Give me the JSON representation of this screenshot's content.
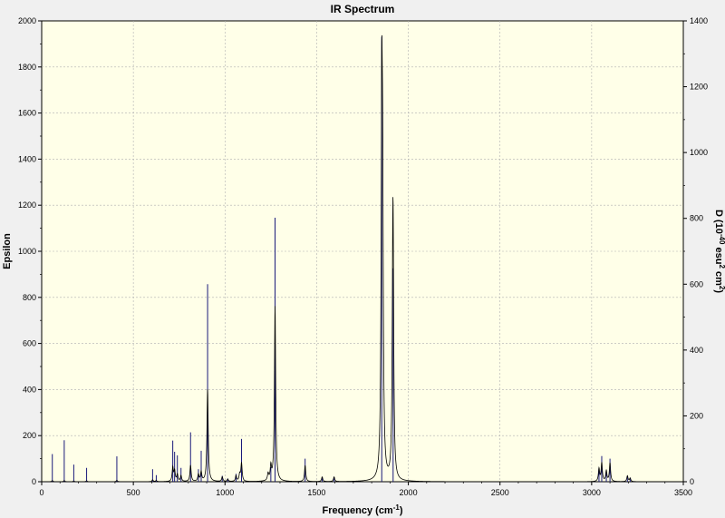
{
  "chart_data": {
    "type": "line",
    "title": "IR Spectrum",
    "xlabel": "Frequency (cm",
    "xlabel_sup": "-1",
    "xlabel_tail": ")",
    "ylabel": "Epsilon",
    "y2label_parts": [
      "D (10",
      "-40",
      " esu",
      "2",
      " cm",
      "2",
      ")"
    ],
    "xlim": [
      0,
      3500
    ],
    "ylim": [
      0,
      2000
    ],
    "y2lim": [
      0,
      1400
    ],
    "x_ticks": [
      "0",
      "500",
      "1000",
      "1500",
      "2000",
      "2500",
      "3000",
      "3500"
    ],
    "y_ticks": [
      "0",
      "200",
      "400",
      "600",
      "800",
      "1000",
      "1200",
      "1400",
      "1600",
      "1800",
      "2000"
    ],
    "y2_ticks": [
      "0",
      "200",
      "400",
      "600",
      "800",
      "1000",
      "1200",
      "1400"
    ],
    "grid": true,
    "plot_background": "#ffffe8",
    "line_color": "#000000",
    "stick_color": "#1a1a7a",
    "curve_range": [
      0,
      3300
    ],
    "peak_width": 4,
    "series": [
      {
        "role": "curve",
        "peaks": [
          {
            "x": 58,
            "y": 5
          },
          {
            "x": 123,
            "y": 5
          },
          {
            "x": 175,
            "y": 3
          },
          {
            "x": 245,
            "y": 4
          },
          {
            "x": 410,
            "y": 6
          },
          {
            "x": 605,
            "y": 8
          },
          {
            "x": 625,
            "y": 5
          },
          {
            "x": 715,
            "y": 60
          },
          {
            "x": 725,
            "y": 45
          },
          {
            "x": 740,
            "y": 30
          },
          {
            "x": 760,
            "y": 25
          },
          {
            "x": 812,
            "y": 70
          },
          {
            "x": 855,
            "y": 30
          },
          {
            "x": 870,
            "y": 40
          },
          {
            "x": 905,
            "y": 400
          },
          {
            "x": 985,
            "y": 20
          },
          {
            "x": 1015,
            "y": 10
          },
          {
            "x": 1060,
            "y": 25
          },
          {
            "x": 1080,
            "y": 30
          },
          {
            "x": 1090,
            "y": 80
          },
          {
            "x": 1235,
            "y": 30
          },
          {
            "x": 1250,
            "y": 60
          },
          {
            "x": 1273,
            "y": 760
          },
          {
            "x": 1437,
            "y": 70
          },
          {
            "x": 1530,
            "y": 20
          },
          {
            "x": 1595,
            "y": 20
          },
          {
            "x": 1855,
            "y": 1500
          },
          {
            "x": 1860,
            "y": 1040
          },
          {
            "x": 1917,
            "y": 800
          },
          {
            "x": 1915,
            "y": 500
          },
          {
            "x": 3040,
            "y": 55
          },
          {
            "x": 3055,
            "y": 80
          },
          {
            "x": 3080,
            "y": 45
          },
          {
            "x": 3100,
            "y": 80
          },
          {
            "x": 3195,
            "y": 25
          },
          {
            "x": 3210,
            "y": 15
          }
        ]
      },
      {
        "role": "sticks",
        "values": [
          {
            "x": 58,
            "d": 84
          },
          {
            "x": 123,
            "d": 126
          },
          {
            "x": 175,
            "d": 52
          },
          {
            "x": 245,
            "d": 42
          },
          {
            "x": 410,
            "d": 77
          },
          {
            "x": 605,
            "d": 38
          },
          {
            "x": 625,
            "d": 20
          },
          {
            "x": 715,
            "d": 125
          },
          {
            "x": 725,
            "d": 91
          },
          {
            "x": 740,
            "d": 80
          },
          {
            "x": 760,
            "d": 42
          },
          {
            "x": 812,
            "d": 150
          },
          {
            "x": 855,
            "d": 38
          },
          {
            "x": 870,
            "d": 94
          },
          {
            "x": 905,
            "d": 600
          },
          {
            "x": 985,
            "d": 18
          },
          {
            "x": 1015,
            "d": 10
          },
          {
            "x": 1060,
            "d": 24
          },
          {
            "x": 1090,
            "d": 130
          },
          {
            "x": 1250,
            "d": 44
          },
          {
            "x": 1273,
            "d": 802
          },
          {
            "x": 1437,
            "d": 70
          },
          {
            "x": 1530,
            "d": 14
          },
          {
            "x": 1595,
            "d": 14
          },
          {
            "x": 1855,
            "d": 1352
          },
          {
            "x": 1917,
            "d": 648
          },
          {
            "x": 3040,
            "d": 38
          },
          {
            "x": 3055,
            "d": 78
          },
          {
            "x": 3080,
            "d": 30
          },
          {
            "x": 3100,
            "d": 70
          },
          {
            "x": 3195,
            "d": 16
          },
          {
            "x": 3210,
            "d": 10
          }
        ]
      }
    ]
  }
}
